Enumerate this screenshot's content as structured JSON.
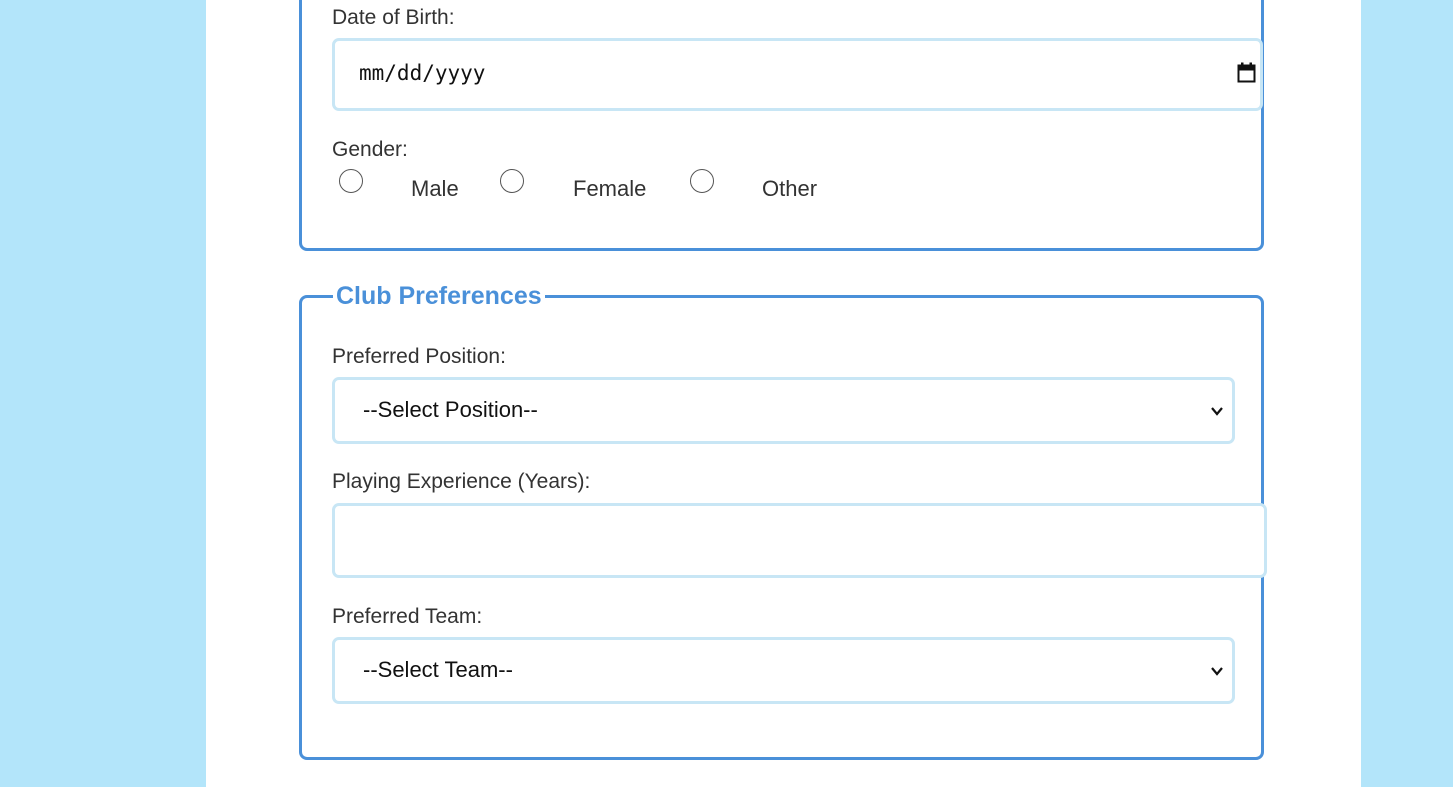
{
  "personal": {
    "dob_label": "Date of Birth:",
    "dob_placeholder": "mm/dd/yyyy",
    "gender_label": "Gender:",
    "gender_options": [
      "Male",
      "Female",
      "Other"
    ]
  },
  "club": {
    "legend": "Club Preferences",
    "position_label": "Preferred Position:",
    "position_selected": "--Select Position--",
    "experience_label": "Playing Experience (Years):",
    "experience_value": "",
    "team_label": "Preferred Team:",
    "team_selected": "--Select Team--"
  },
  "colors": {
    "page_background": "#b3e5fa",
    "accent": "#4a90d9",
    "input_border": "#c8e6f5"
  },
  "icons": {
    "calendar": "calendar-icon",
    "dropdown": "chevron-down-icon"
  }
}
